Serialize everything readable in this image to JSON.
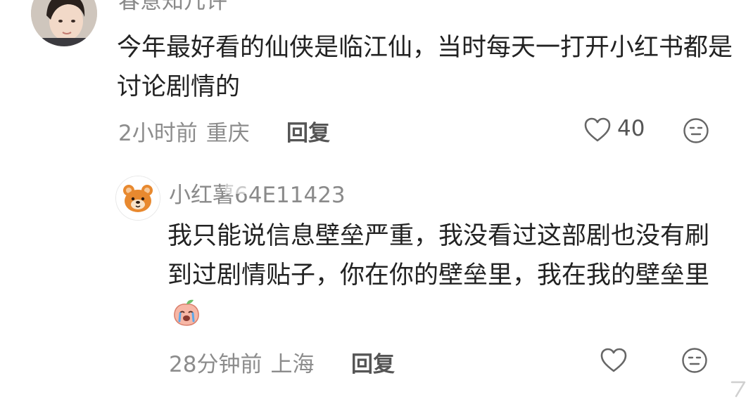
{
  "comment": {
    "username": "春意知几许",
    "content": "今年最好看的仙侠是临江仙，当时每天一打开小红书都是讨论剧情的",
    "time": "2小时前",
    "location": "重庆",
    "reply_label": "回复",
    "like_count": "40",
    "like_icon": "heart-outline-icon",
    "emoji_icon": "emoji-face-icon"
  },
  "reply": {
    "username": "小红薯64E11423",
    "content": "我只能说信息壁垒严重，我没看过这部剧也没有刷到过剧情贴子，你在你的壁垒里，我在我的壁垒里",
    "inline_emoji": "crying-peach-emoji",
    "time": "28分钟前",
    "location": "上海",
    "reply_label": "回复",
    "like_icon": "heart-outline-icon",
    "emoji_icon": "emoji-face-icon"
  },
  "colors": {
    "text_primary": "#222222",
    "text_secondary": "#8c8c8c",
    "icon": "#666666"
  }
}
